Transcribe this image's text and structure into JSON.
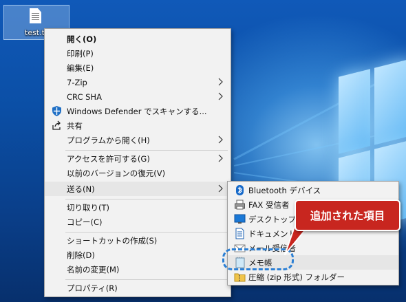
{
  "desktop": {
    "file_name": "test.txt"
  },
  "context_menu": {
    "items": [
      {
        "label": "開く(O)"
      },
      {
        "label": "印刷(P)"
      },
      {
        "label": "編集(E)"
      },
      {
        "label": "7-Zip"
      },
      {
        "label": "CRC SHA"
      },
      {
        "label": "Windows Defender でスキャンする..."
      },
      {
        "label": "共有"
      },
      {
        "label": "プログラムから開く(H)"
      },
      {
        "label": "アクセスを許可する(G)"
      },
      {
        "label": "以前のバージョンの復元(V)"
      },
      {
        "label": "送る(N)"
      },
      {
        "label": "切り取り(T)"
      },
      {
        "label": "コピー(C)"
      },
      {
        "label": "ショートカットの作成(S)"
      },
      {
        "label": "削除(D)"
      },
      {
        "label": "名前の変更(M)"
      },
      {
        "label": "プロパティ(R)"
      }
    ],
    "highlighted_item": "送る(N)"
  },
  "send_to_menu": {
    "items": [
      {
        "label": "Bluetooth デバイス",
        "icon": "bluetooth-icon"
      },
      {
        "label": "FAX 受信者",
        "icon": "fax-icon"
      },
      {
        "label": "デスクトップ (ショートカットを作成)",
        "icon": "desktop-icon"
      },
      {
        "label": "ドキュメント",
        "icon": "document-icon"
      },
      {
        "label": "メール受信者",
        "icon": "mail-icon"
      },
      {
        "label": "メモ帳",
        "icon": "notepad-icon"
      },
      {
        "label": "圧縮 (zip 形式) フォルダー",
        "icon": "zip-folder-icon"
      }
    ],
    "highlighted_item": "メモ帳"
  },
  "callout": {
    "text": "追加された項目",
    "color": "#c8261f"
  },
  "colors": {
    "menu_bg": "#f2f2f2",
    "highlight": "#e6e6e6",
    "desktop_blue": "#0b4fa6",
    "dash_ring": "#2b7fd4"
  }
}
